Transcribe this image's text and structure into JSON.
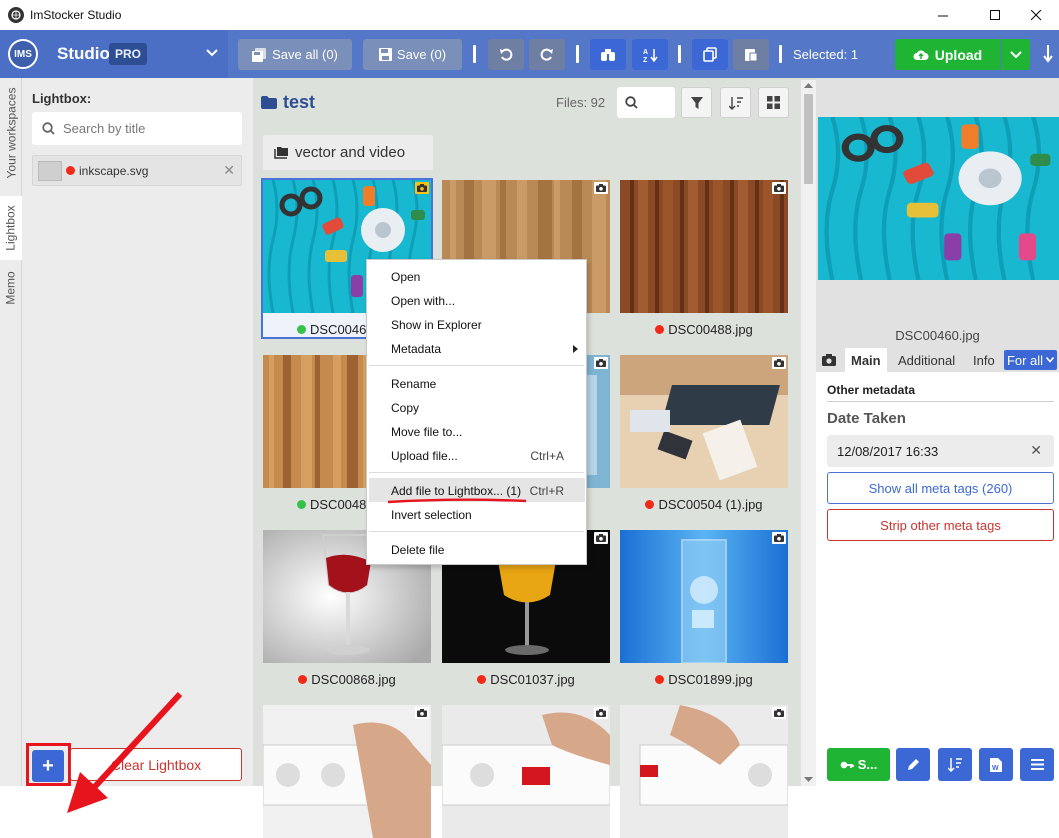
{
  "window": {
    "title": "ImStocker Studio"
  },
  "toolbar": {
    "logo_text": "IMS",
    "studio_label": "Studio",
    "pro_badge": "PRO",
    "save_all": "Save all (0)",
    "save": "Save (0)",
    "selected": "Selected: 1",
    "upload": "Upload"
  },
  "vtabs": {
    "workspaces": "Your workspaces",
    "lightbox": "Lightbox",
    "memo": "Memo"
  },
  "lightbox": {
    "title": "Lightbox:",
    "search_placeholder": "Search by title",
    "item_name": "inkscape.svg",
    "clear_label": "Clear Lightbox",
    "add_label": "+"
  },
  "center": {
    "folder": "test",
    "files_count": "Files: 92",
    "subfolder": "vector and video",
    "tiles": [
      {
        "name": "DSC0046",
        "status": "green",
        "img": "thread"
      },
      {
        "name": "",
        "status": "",
        "img": "wood1"
      },
      {
        "name": "DSC00488.jpg",
        "status": "red",
        "img": "wood2"
      },
      {
        "name": "DSC0048",
        "status": "green",
        "img": "wood3"
      },
      {
        "name": "",
        "status": "",
        "img": "ice"
      },
      {
        "name": "DSC00504 (1).jpg",
        "status": "red",
        "img": "desk"
      },
      {
        "name": "DSC00868.jpg",
        "status": "red",
        "img": "wine"
      },
      {
        "name": "DSC01037.jpg",
        "status": "red",
        "img": "orange"
      },
      {
        "name": "DSC01899.jpg",
        "status": "red",
        "img": "water"
      },
      {
        "name": "",
        "status": "",
        "img": "socket1"
      },
      {
        "name": "",
        "status": "",
        "img": "socket2"
      },
      {
        "name": "",
        "status": "",
        "img": "socket3"
      }
    ]
  },
  "context_menu": {
    "open": "Open",
    "open_with": "Open with...",
    "show_in_explorer": "Show in Explorer",
    "metadata": "Metadata",
    "rename": "Rename",
    "copy": "Copy",
    "move_file": "Move file to...",
    "upload_file": "Upload file...",
    "upload_shortcut": "Ctrl+A",
    "add_to_lightbox": "Add file to Lightbox... (1)",
    "add_shortcut": "Ctrl+R",
    "invert_selection": "Invert selection",
    "delete_file": "Delete file"
  },
  "right": {
    "preview_name": "DSC00460.jpg",
    "tab_main": "Main",
    "tab_additional": "Additional",
    "tab_info": "Info",
    "for_all": "For all",
    "other_metadata": "Other metadata",
    "date_taken_label": "Date Taken",
    "date_taken_value": "12/08/2017 16:33",
    "show_all_meta": "Show all meta tags (260)",
    "strip_meta": "Strip other meta tags",
    "bottom_green_label": "S..."
  },
  "colors": {
    "accent": "#3c68d6",
    "toolbar": "#4a6fc4",
    "upload": "#1fb433",
    "danger": "#c9342e",
    "status_red": "#f02a16",
    "status_green": "#36c24a"
  }
}
